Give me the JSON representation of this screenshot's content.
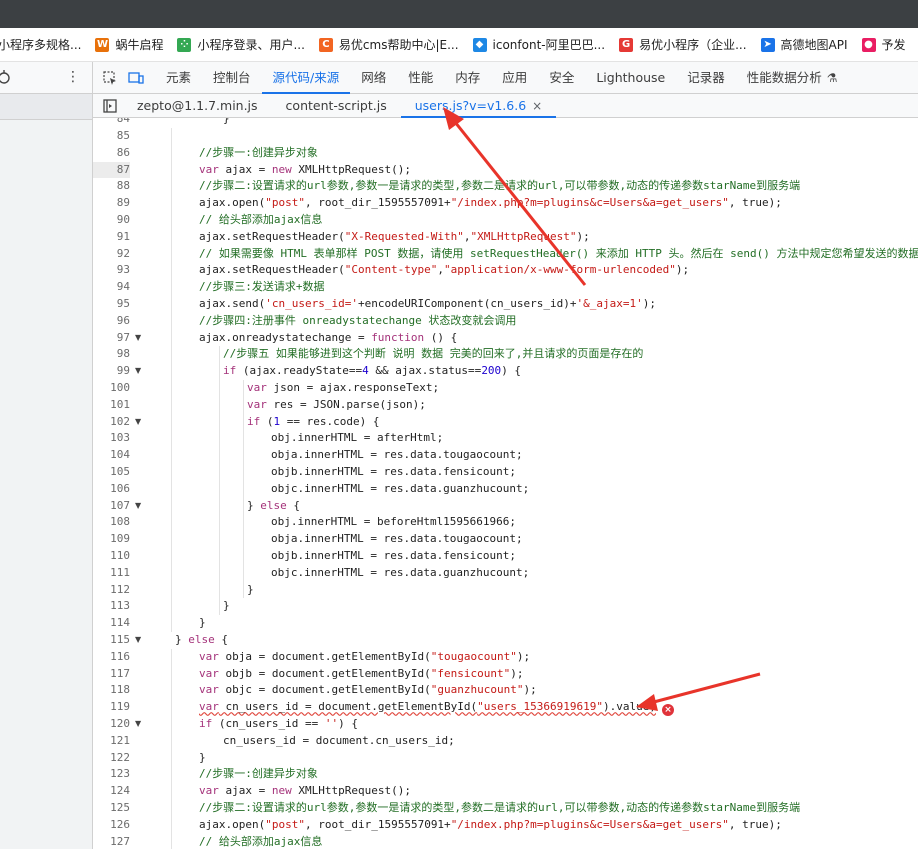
{
  "bookmarks": [
    {
      "label": "小程序多规格...",
      "icon": "page-icon",
      "color": "#5f6368"
    },
    {
      "label": "蜗牛启程",
      "icon": "w-logo-icon",
      "color": "#e8710a"
    },
    {
      "label": "小程序登录、用户...",
      "icon": "grid-logo-icon",
      "color": "#34a853"
    },
    {
      "label": "易优cms帮助中心|E...",
      "icon": "c-logo-icon",
      "color": "#f26522"
    },
    {
      "label": "iconfont-阿里巴巴...",
      "icon": "iconfont-logo-icon",
      "color": "#1e88e5"
    },
    {
      "label": "易优小程序（企业...",
      "icon": "g-logo-icon",
      "color": "#e53935"
    },
    {
      "label": "高德地图API",
      "icon": "amap-logo-icon",
      "color": "#1a73e8"
    },
    {
      "label": "予发",
      "icon": "circle-logo-icon",
      "color": "#e91e63"
    }
  ],
  "devtools_tabs": [
    "元素",
    "控制台",
    "源代码/来源",
    "网络",
    "性能",
    "内存",
    "应用",
    "安全",
    "Lighthouse",
    "记录器",
    "性能数据分析"
  ],
  "active_devtools_tab": "源代码/来源",
  "file_tabs": [
    "zepto@1.1.7.min.js",
    "content-script.js",
    "users.js?v=v1.6.6"
  ],
  "active_file_tab": "users.js?v=v1.6.6",
  "close_symbol": "×",
  "error_symbol": "×",
  "current_line": 87,
  "first_line_partial": "84",
  "code_lines": [
    {
      "n": 85,
      "d": 0,
      "t": ""
    },
    {
      "n": 86,
      "d": 2,
      "t": "//步骤一:创建异步对象",
      "c": true
    },
    {
      "n": 87,
      "d": 2,
      "t": "var ajax = new XMLHttpRequest();"
    },
    {
      "n": 88,
      "d": 2,
      "t": "//步骤二:设置请求的url参数,参数一是请求的类型,参数二是请求的url,可以带参数,动态的传递参数starName到服务端",
      "c": true
    },
    {
      "n": 89,
      "d": 2,
      "t": "ajax.open(\"post\", root_dir_1595557091+\"/index.php?m=plugins&c=Users&a=get_users\", true);"
    },
    {
      "n": 90,
      "d": 2,
      "t": "// 给头部添加ajax信息",
      "c": true
    },
    {
      "n": 91,
      "d": 2,
      "t": "ajax.setRequestHeader(\"X-Requested-With\",\"XMLHttpRequest\");"
    },
    {
      "n": 92,
      "d": 2,
      "t": "// 如果需要像 HTML 表单那样 POST 数据，请使用 setRequestHeader() 来添加 HTTP 头。然后在 send() 方法中规定您希望发送的数据",
      "c": true
    },
    {
      "n": 93,
      "d": 2,
      "t": "ajax.setRequestHeader(\"Content-type\",\"application/x-www-form-urlencoded\");"
    },
    {
      "n": 94,
      "d": 2,
      "t": "//步骤三:发送请求+数据",
      "c": true
    },
    {
      "n": 95,
      "d": 2,
      "t": "ajax.send('cn_users_id='+encodeURIComponent(cn_users_id)+'&_ajax=1');"
    },
    {
      "n": 96,
      "d": 2,
      "t": "//步骤四:注册事件 onreadystatechange 状态改变就会调用",
      "c": true
    },
    {
      "n": 97,
      "d": 2,
      "t": "ajax.onreadystatechange = function () {",
      "f": true
    },
    {
      "n": 98,
      "d": 3,
      "t": "//步骤五 如果能够进到这个判断 说明 数据 完美的回来了,并且请求的页面是存在的",
      "c": true
    },
    {
      "n": 99,
      "d": 3,
      "t": "if (ajax.readyState==4 && ajax.status==200) {",
      "f": true
    },
    {
      "n": 100,
      "d": 4,
      "t": "var json = ajax.responseText;"
    },
    {
      "n": 101,
      "d": 4,
      "t": "var res = JSON.parse(json);"
    },
    {
      "n": 102,
      "d": 4,
      "t": "if (1 == res.code) {",
      "f": true
    },
    {
      "n": 103,
      "d": 5,
      "t": "obj.innerHTML = afterHtml;"
    },
    {
      "n": 104,
      "d": 5,
      "t": "obja.innerHTML = res.data.tougaocount;"
    },
    {
      "n": 105,
      "d": 5,
      "t": "objb.innerHTML = res.data.fensicount;"
    },
    {
      "n": 106,
      "d": 5,
      "t": "objc.innerHTML = res.data.guanzhucount;"
    },
    {
      "n": 107,
      "d": 4,
      "t": "} else {",
      "f": true
    },
    {
      "n": 108,
      "d": 5,
      "t": "obj.innerHTML = beforeHtml1595661966;"
    },
    {
      "n": 109,
      "d": 5,
      "t": "obja.innerHTML = res.data.tougaocount;"
    },
    {
      "n": 110,
      "d": 5,
      "t": "objb.innerHTML = res.data.fensicount;"
    },
    {
      "n": 111,
      "d": 5,
      "t": "objc.innerHTML = res.data.guanzhucount;"
    },
    {
      "n": 112,
      "d": 4,
      "t": "}"
    },
    {
      "n": 113,
      "d": 3,
      "t": "}"
    },
    {
      "n": 114,
      "d": 2,
      "t": "}"
    },
    {
      "n": 115,
      "d": 1,
      "t": "} else {",
      "f": true
    },
    {
      "n": 116,
      "d": 2,
      "t": "var obja = document.getElementById(\"tougaocount\");"
    },
    {
      "n": 117,
      "d": 2,
      "t": "var objb = document.getElementById(\"fensicount\");"
    },
    {
      "n": 118,
      "d": 2,
      "t": "var objc = document.getElementById(\"guanzhucount\");"
    },
    {
      "n": 119,
      "d": 2,
      "t": "var cn_users_id = document.getElementById(\"users_15366919619\").value;",
      "e": true
    },
    {
      "n": 120,
      "d": 2,
      "t": "if (cn_users_id == '') {",
      "f": true
    },
    {
      "n": 121,
      "d": 3,
      "t": "cn_users_id = document.cn_users_id;"
    },
    {
      "n": 122,
      "d": 2,
      "t": "}"
    },
    {
      "n": 123,
      "d": 2,
      "t": "//步骤一:创建异步对象",
      "c": true
    },
    {
      "n": 124,
      "d": 2,
      "t": "var ajax = new XMLHttpRequest();"
    },
    {
      "n": 125,
      "d": 2,
      "t": "//步骤二:设置请求的url参数,参数一是请求的类型,参数二是请求的url,可以带参数,动态的传递参数starName到服务端",
      "c": true
    },
    {
      "n": 126,
      "d": 2,
      "t": "ajax.open(\"post\", root_dir_1595557091+\"/index.php?m=plugins&c=Users&a=get_users\", true);"
    },
    {
      "n": 127,
      "d": 2,
      "t": "// 给头部添加ajax信息",
      "c": true
    }
  ],
  "colors": {
    "accent": "#1a73e8",
    "annotation_arrow": "#e8342a",
    "keyword": "#a4327a",
    "string": "#c41a16",
    "comment": "#236e25",
    "number": "#1c00cf"
  }
}
